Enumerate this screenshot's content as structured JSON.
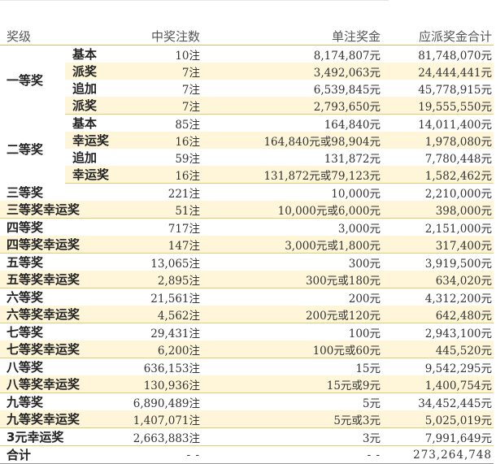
{
  "headers": {
    "level": "奖级",
    "count": "中奖注数",
    "single": "单注奖金",
    "total": "应派奖金合计"
  },
  "groups": [
    {
      "level": "一等奖",
      "rows": [
        {
          "sub": "基本",
          "count": "10注",
          "single": "8,174,807元",
          "total": "81,748,070元"
        },
        {
          "sub": "派奖",
          "count": "7注",
          "single": "3,492,063元",
          "total": "24,444,441元"
        },
        {
          "sub": "追加",
          "count": "7注",
          "single": "6,539,845元",
          "total": "45,778,915元"
        },
        {
          "sub": "派奖",
          "count": "7注",
          "single": "2,793,650元",
          "total": "19,555,550元"
        }
      ]
    },
    {
      "level": "二等奖",
      "rows": [
        {
          "sub": "基本",
          "count": "85注",
          "single": "164,840元",
          "total": "14,011,400元"
        },
        {
          "sub": "幸运奖",
          "count": "16注",
          "single": "164,840元或98,904元",
          "total": "1,978,080元"
        },
        {
          "sub": "追加",
          "count": "59注",
          "single": "131,872元",
          "total": "7,780,448元"
        },
        {
          "sub": "幸运奖",
          "count": "16注",
          "single": "131,872元或79,123元",
          "total": "1,582,462元"
        }
      ]
    }
  ],
  "rows": [
    {
      "level": "三等奖",
      "count": "221注",
      "single": "10,000元",
      "total": "2,210,000元"
    },
    {
      "level": "三等奖幸运奖",
      "count": "51注",
      "single": "10,000元或6,000元",
      "total": "398,000元"
    },
    {
      "level": "四等奖",
      "count": "717注",
      "single": "3,000元",
      "total": "2,151,000元"
    },
    {
      "level": "四等奖幸运奖",
      "count": "147注",
      "single": "3,000元或1,800元",
      "total": "317,400元"
    },
    {
      "level": "五等奖",
      "count": "13,065注",
      "single": "300元",
      "total": "3,919,500元"
    },
    {
      "level": "五等奖幸运奖",
      "count": "2,895注",
      "single": "300元或180元",
      "total": "634,020元"
    },
    {
      "level": "六等奖",
      "count": "21,561注",
      "single": "200元",
      "total": "4,312,200元"
    },
    {
      "level": "六等奖幸运奖",
      "count": "4,562注",
      "single": "200元或120元",
      "total": "642,480元"
    },
    {
      "level": "七等奖",
      "count": "29,431注",
      "single": "100元",
      "total": "2,943,100元"
    },
    {
      "level": "七等奖幸运奖",
      "count": "6,200注",
      "single": "100元或60元",
      "total": "445,520元"
    },
    {
      "level": "八等奖",
      "count": "636,153注",
      "single": "15元",
      "total": "9,542,295元"
    },
    {
      "level": "八等奖幸运奖",
      "count": "130,936注",
      "single": "15元或9元",
      "total": "1,400,754元"
    },
    {
      "level": "九等奖",
      "count": "6,890,489注",
      "single": "5元",
      "total": "34,452,445元"
    },
    {
      "level": "九等奖幸运奖",
      "count": "1,407,071注",
      "single": "5元或3元",
      "total": "5,025,019元"
    },
    {
      "level": "3元幸运奖",
      "count": "2,663,883注",
      "single": "3元",
      "total": "7,991,649元"
    }
  ],
  "footer": {
    "label": "合计",
    "count": "- -",
    "single": "- -",
    "total": "273,264,748"
  }
}
